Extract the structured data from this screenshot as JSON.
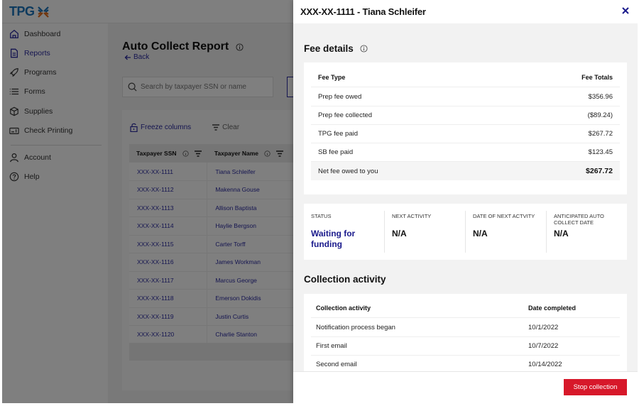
{
  "brand": {
    "logo_text": "TPG",
    "colors": {
      "primary_blue": "#1b75bc",
      "accent_orange": "#e36c1d",
      "link_navy": "#2a2aa0",
      "danger_red": "#d7182a"
    }
  },
  "sidebar": {
    "items": [
      {
        "label": "Dashboard",
        "icon": "home-icon",
        "active": false
      },
      {
        "label": "Reports",
        "icon": "document-icon",
        "active": true
      },
      {
        "label": "Programs",
        "icon": "rocket-icon",
        "active": false
      },
      {
        "label": "Forms",
        "icon": "list-icon",
        "active": false
      },
      {
        "label": "Supplies",
        "icon": "box-icon",
        "active": false
      },
      {
        "label": "Check Printing",
        "icon": "check-printer-icon",
        "active": false
      },
      {
        "label": "Account",
        "icon": "user-icon",
        "active": false
      },
      {
        "label": "Help",
        "icon": "help-icon",
        "active": false
      }
    ]
  },
  "page": {
    "title": "Auto Collect Report",
    "back_label": "Back",
    "search_placeholder": "Search by taxpayer SSN or name",
    "freeze_label": "Freeze columns",
    "clear_label": "Clear"
  },
  "table": {
    "columns": [
      "Taxpayer SSN",
      "Taxpayer Name"
    ],
    "rows": [
      [
        "XXX-XX-1111",
        "Tiana Schleifer"
      ],
      [
        "XXX-XX-1112",
        "Makenna Gouse"
      ],
      [
        "XXX-XX-1113",
        "Allison Baptista"
      ],
      [
        "XXX-XX-1114",
        "Haylie Bergson"
      ],
      [
        "XXX-XX-1115",
        "Carter Torff"
      ],
      [
        "XXX-XX-1116",
        "James Workman"
      ],
      [
        "XXX-XX-1117",
        "Marcus George"
      ],
      [
        "XXX-XX-1118",
        "Emerson Dokidis"
      ],
      [
        "XXX-XX-1119",
        "Justin Curtis"
      ],
      [
        "XXX-XX-1120",
        "Charlie Stanton"
      ]
    ]
  },
  "drawer": {
    "title": "XXX-XX-1111 - Tiana Schleifer",
    "fee_details": {
      "title": "Fee details",
      "header": {
        "type": "Fee Type",
        "total": "Fee Totals"
      },
      "rows": [
        {
          "label": "Prep fee owed",
          "value": "$356.96"
        },
        {
          "label": "Prep fee collected",
          "value": "($89.24)"
        },
        {
          "label": "TPG fee paid",
          "value": "$267.72"
        },
        {
          "label": "SB fee paid",
          "value": "$123.45"
        }
      ],
      "total": {
        "label": "Net fee owed to you",
        "value": "$267.72"
      }
    },
    "status": [
      {
        "label": "STATUS",
        "value": "Waiting for funding"
      },
      {
        "label": "NEXT ACTIVITY",
        "value": "N/A"
      },
      {
        "label": "DATE OF NEXT ACTVITY",
        "value": "N/A"
      },
      {
        "label": "ANTICIPATED AUTO COLLECT DATE",
        "value": "N/A"
      }
    ],
    "activity": {
      "title": "Collection activity",
      "header": {
        "activity": "Collection activity",
        "date": "Date completed"
      },
      "rows": [
        {
          "activity": "Notification process began",
          "date": "10/1/2022"
        },
        {
          "activity": "First email",
          "date": "10/7/2022"
        },
        {
          "activity": "Second email",
          "date": "10/14/2022"
        }
      ]
    },
    "stop_button_label": "Stop collection"
  }
}
